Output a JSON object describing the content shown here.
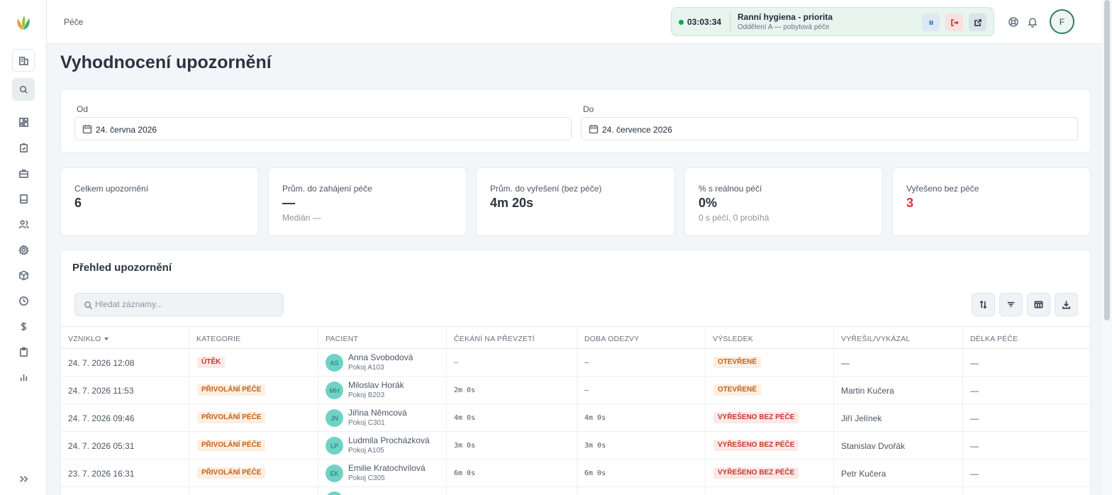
{
  "app": {
    "breadcrumb": "Péče"
  },
  "session": {
    "timer": "03:03:34",
    "title": "Ranní hygiena - priorita",
    "subtitle": "Oddělení A — pobytová péče",
    "pause_icon": "pause-icon",
    "exit_icon": "exit-icon",
    "open_icon": "external-link-icon"
  },
  "user": {
    "avatar_initial": "F"
  },
  "sidebar": {
    "icons": [
      "building-icon",
      "search-icon",
      "dashboard-icon",
      "clipboard-check-icon",
      "briefcase-icon",
      "archive-icon",
      "users-icon",
      "settings-icon",
      "package-icon",
      "clock-icon",
      "dollar-icon",
      "clipboard-icon",
      "bar-chart-icon"
    ],
    "expand_icon": "chevrons-right-icon"
  },
  "page": {
    "title": "Vyhodnocení upozornění"
  },
  "filters": {
    "from_label": "Od",
    "from_value": "24. června 2026",
    "to_label": "Do",
    "to_value": "24. července 2026"
  },
  "stats": [
    {
      "label": "Celkem upozornění",
      "value": "6",
      "sub": ""
    },
    {
      "label": "Prům. do zahájení péče",
      "value": "—",
      "sub": "Medián —"
    },
    {
      "label": "Prům. do vyřešení (bez péče)",
      "value": "4m 20s",
      "sub": ""
    },
    {
      "label": "% s reálnou péčí",
      "value": "0%",
      "sub": "0 s péčí, 0 probíhá"
    },
    {
      "label": "Vyřešeno bez péče",
      "value": "3",
      "sub": "",
      "value_color": "#d13b3b"
    }
  ],
  "overview": {
    "title": "Přehled upozornění",
    "search_placeholder": "Hledat záznamy...",
    "toolbar_icons": [
      "sort-icon",
      "filter-icon",
      "columns-icon",
      "download-icon"
    ],
    "columns": [
      "VZNIKLO",
      "KATEGORIE",
      "PACIENT",
      "ČEKÁNÍ NA PŘEVZETÍ",
      "DOBA ODEZVY",
      "VÝSLEDEK",
      "VYŘEŠIL/VYKÁZAL",
      "DÉLKA PÉČE"
    ],
    "rows": [
      {
        "created": "24. 7. 2026 12:08",
        "category": "ÚTĚK",
        "initials": "AS",
        "patient": "Anna Svobodová",
        "room": "Pokoj A103",
        "wait": "–",
        "response": "–",
        "result": "OTEVŘENÉ",
        "resolver": "—",
        "duration": "—"
      },
      {
        "created": "24. 7. 2026 11:53",
        "category": "PŘIVOLÁNÍ PÉČE",
        "initials": "MH",
        "patient": "Miloslav Horák",
        "room": "Pokoj B203",
        "wait": "2m 0s",
        "response": "–",
        "result": "OTEVŘENÉ",
        "resolver": "Martin Kučera",
        "duration": "—"
      },
      {
        "created": "24. 7. 2026 09:46",
        "category": "PŘIVOLÁNÍ PÉČE",
        "initials": "JN",
        "patient": "Jiřina Němcová",
        "room": "Pokoj C301",
        "wait": "4m 0s",
        "response": "4m 0s",
        "result": "VYŘEŠENO BEZ PÉČE",
        "resolver": "Jiří Jelínek",
        "duration": "—"
      },
      {
        "created": "24. 7. 2026 05:31",
        "category": "PŘIVOLÁNÍ PÉČE",
        "initials": "LP",
        "patient": "Ludmila Procházková",
        "room": "Pokoj A105",
        "wait": "3m 0s",
        "response": "3m 0s",
        "result": "VYŘEŠENO BEZ PÉČE",
        "resolver": "Stanislav Dvořák",
        "duration": "—"
      },
      {
        "created": "23. 7. 2026 16:31",
        "category": "PŘIVOLÁNÍ PÉČE",
        "initials": "EK",
        "patient": "Emilie Kratochvílová",
        "room": "Pokoj C305",
        "wait": "6m 0s",
        "response": "6m 0s",
        "result": "VYŘEŠENO BEZ PÉČE",
        "resolver": "Petr Kučera",
        "duration": "—"
      }
    ]
  },
  "colors": {
    "accent_green": "#2f7d60",
    "badge_red_bg": "#fde8e8",
    "badge_red_text": "#c0392b",
    "badge_orange_bg": "#fdeee0",
    "badge_orange_text": "#c2631a",
    "avatar_teal": "#6ed3c6"
  }
}
